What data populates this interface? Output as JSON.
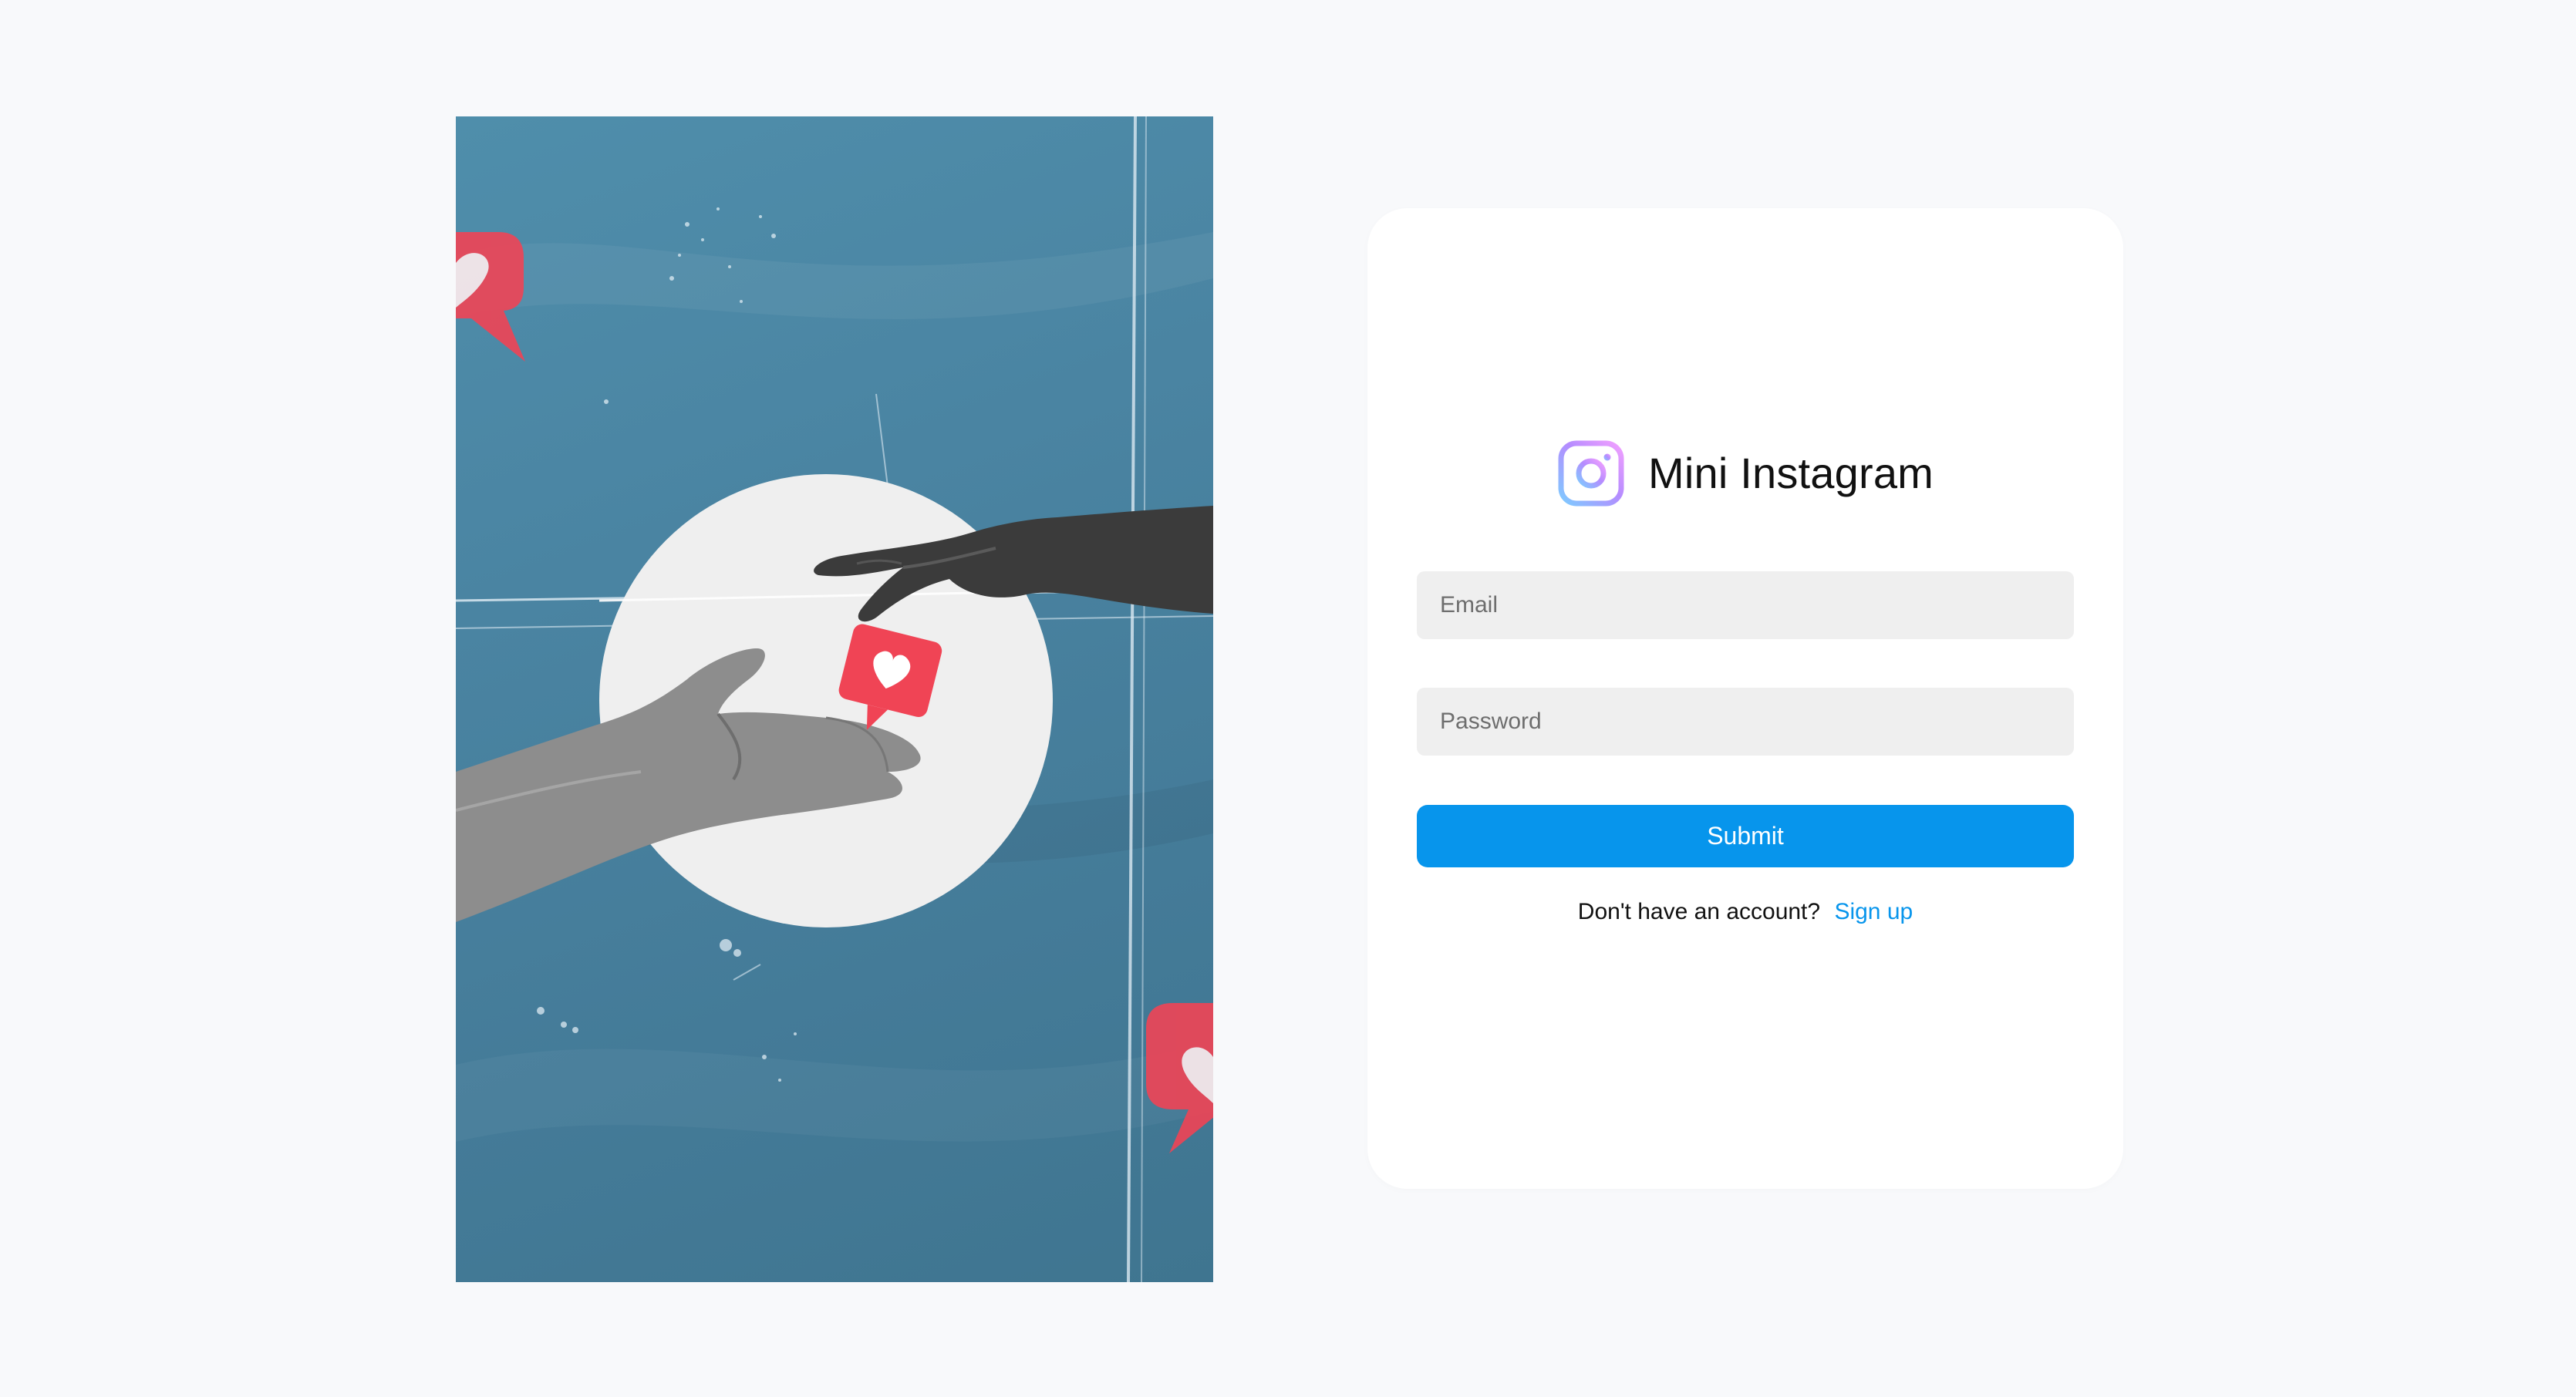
{
  "brand": {
    "title": "Mini Instagram",
    "icon": "instagram-logo-icon"
  },
  "form": {
    "email_placeholder": "Email",
    "email_value": "",
    "password_placeholder": "Password",
    "password_value": "",
    "submit_label": "Submit"
  },
  "signup": {
    "prompt": "Don't have an account?",
    "link_label": "Sign up"
  },
  "illustration": {
    "icons": [
      "hand-reaching-icon",
      "hand-open-icon",
      "heart-like-icon"
    ]
  },
  "colors": {
    "page_background": "#f8f9fb",
    "hero_blue": "#4a84a2",
    "accent": "#0795ec",
    "like_red": "#f04455",
    "input_background": "#efefef",
    "card_background": "#ffffff"
  }
}
